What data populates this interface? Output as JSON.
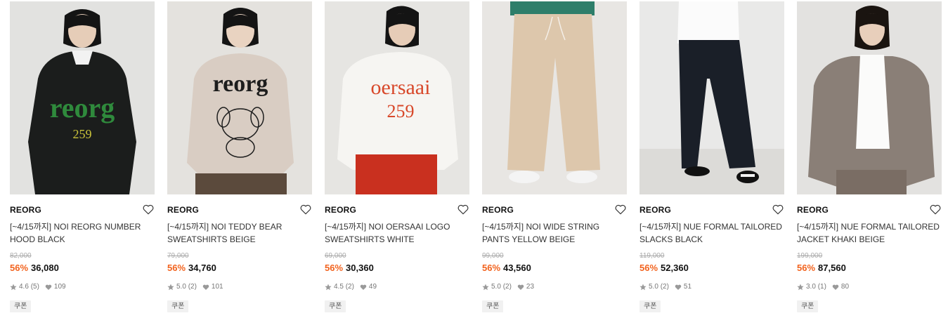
{
  "products": [
    {
      "brand": "REORG",
      "name": "[~4/15까지] NOI REORG NUMBER HOOD BLACK",
      "original_price": "82,000",
      "discount": "56%",
      "price": "36,080",
      "rating": "4.6",
      "review_count": "(5)",
      "likes": "109",
      "badge": "쿠폰",
      "colors": {
        "bg": "#e2e2e0",
        "garment": "#1b1d1c",
        "print": "#2f8a3c",
        "print_text": "reorg",
        "print_sub": "259"
      }
    },
    {
      "brand": "REORG",
      "name": "[~4/15까지] NOI TEDDY BEAR SWEATSHIRTS BEIGE",
      "original_price": "79,000",
      "discount": "56%",
      "price": "34,760",
      "rating": "5.0",
      "review_count": "(2)",
      "likes": "101",
      "badge": "쿠폰",
      "colors": {
        "bg": "#e4e2de",
        "garment": "#d9cdc3",
        "print": "#1d1d1d",
        "print_text": "reorg",
        "print_sub": ""
      }
    },
    {
      "brand": "REORG",
      "name": "[~4/15까지] NOI OERSAAI LOGO SWEATSHIRTS WHITE",
      "original_price": "69,000",
      "discount": "56%",
      "price": "30,360",
      "rating": "4.5",
      "review_count": "(2)",
      "likes": "49",
      "badge": "쿠폰",
      "colors": {
        "bg": "#e6e5e2",
        "garment": "#f6f5f2",
        "print": "#d8482a",
        "print_text": "oersaai",
        "print_sub": "259"
      }
    },
    {
      "brand": "REORG",
      "name": "[~4/15까지] NOI WIDE STRING PANTS YELLOW BEIGE",
      "original_price": "99,000",
      "discount": "56%",
      "price": "43,560",
      "rating": "5.0",
      "review_count": "(2)",
      "likes": "23",
      "badge": "쿠폰",
      "colors": {
        "bg": "#e8e6e3",
        "garment": "#ddc7ac",
        "print": "#2e7e6a",
        "print_text": "",
        "print_sub": ""
      }
    },
    {
      "brand": "REORG",
      "name": "[~4/15까지] NUE FORMAL TAILORED SLACKS BLACK",
      "original_price": "119,000",
      "discount": "56%",
      "price": "52,360",
      "rating": "5.0",
      "review_count": "(2)",
      "likes": "51",
      "badge": "쿠폰",
      "colors": {
        "bg": "#e9e9e8",
        "garment": "#1a1f28",
        "print": "#ffffff",
        "print_text": "",
        "print_sub": ""
      }
    },
    {
      "brand": "REORG",
      "name": "[~4/15까지] NUE FORMAL TAILORED JACKET KHAKI BEIGE",
      "original_price": "199,000",
      "discount": "56%",
      "price": "87,560",
      "rating": "3.0",
      "review_count": "(1)",
      "likes": "80",
      "badge": "쿠폰",
      "colors": {
        "bg": "#e3e2e0",
        "garment": "#8a7f77",
        "print": "#ffffff",
        "print_text": "",
        "print_sub": ""
      }
    }
  ]
}
